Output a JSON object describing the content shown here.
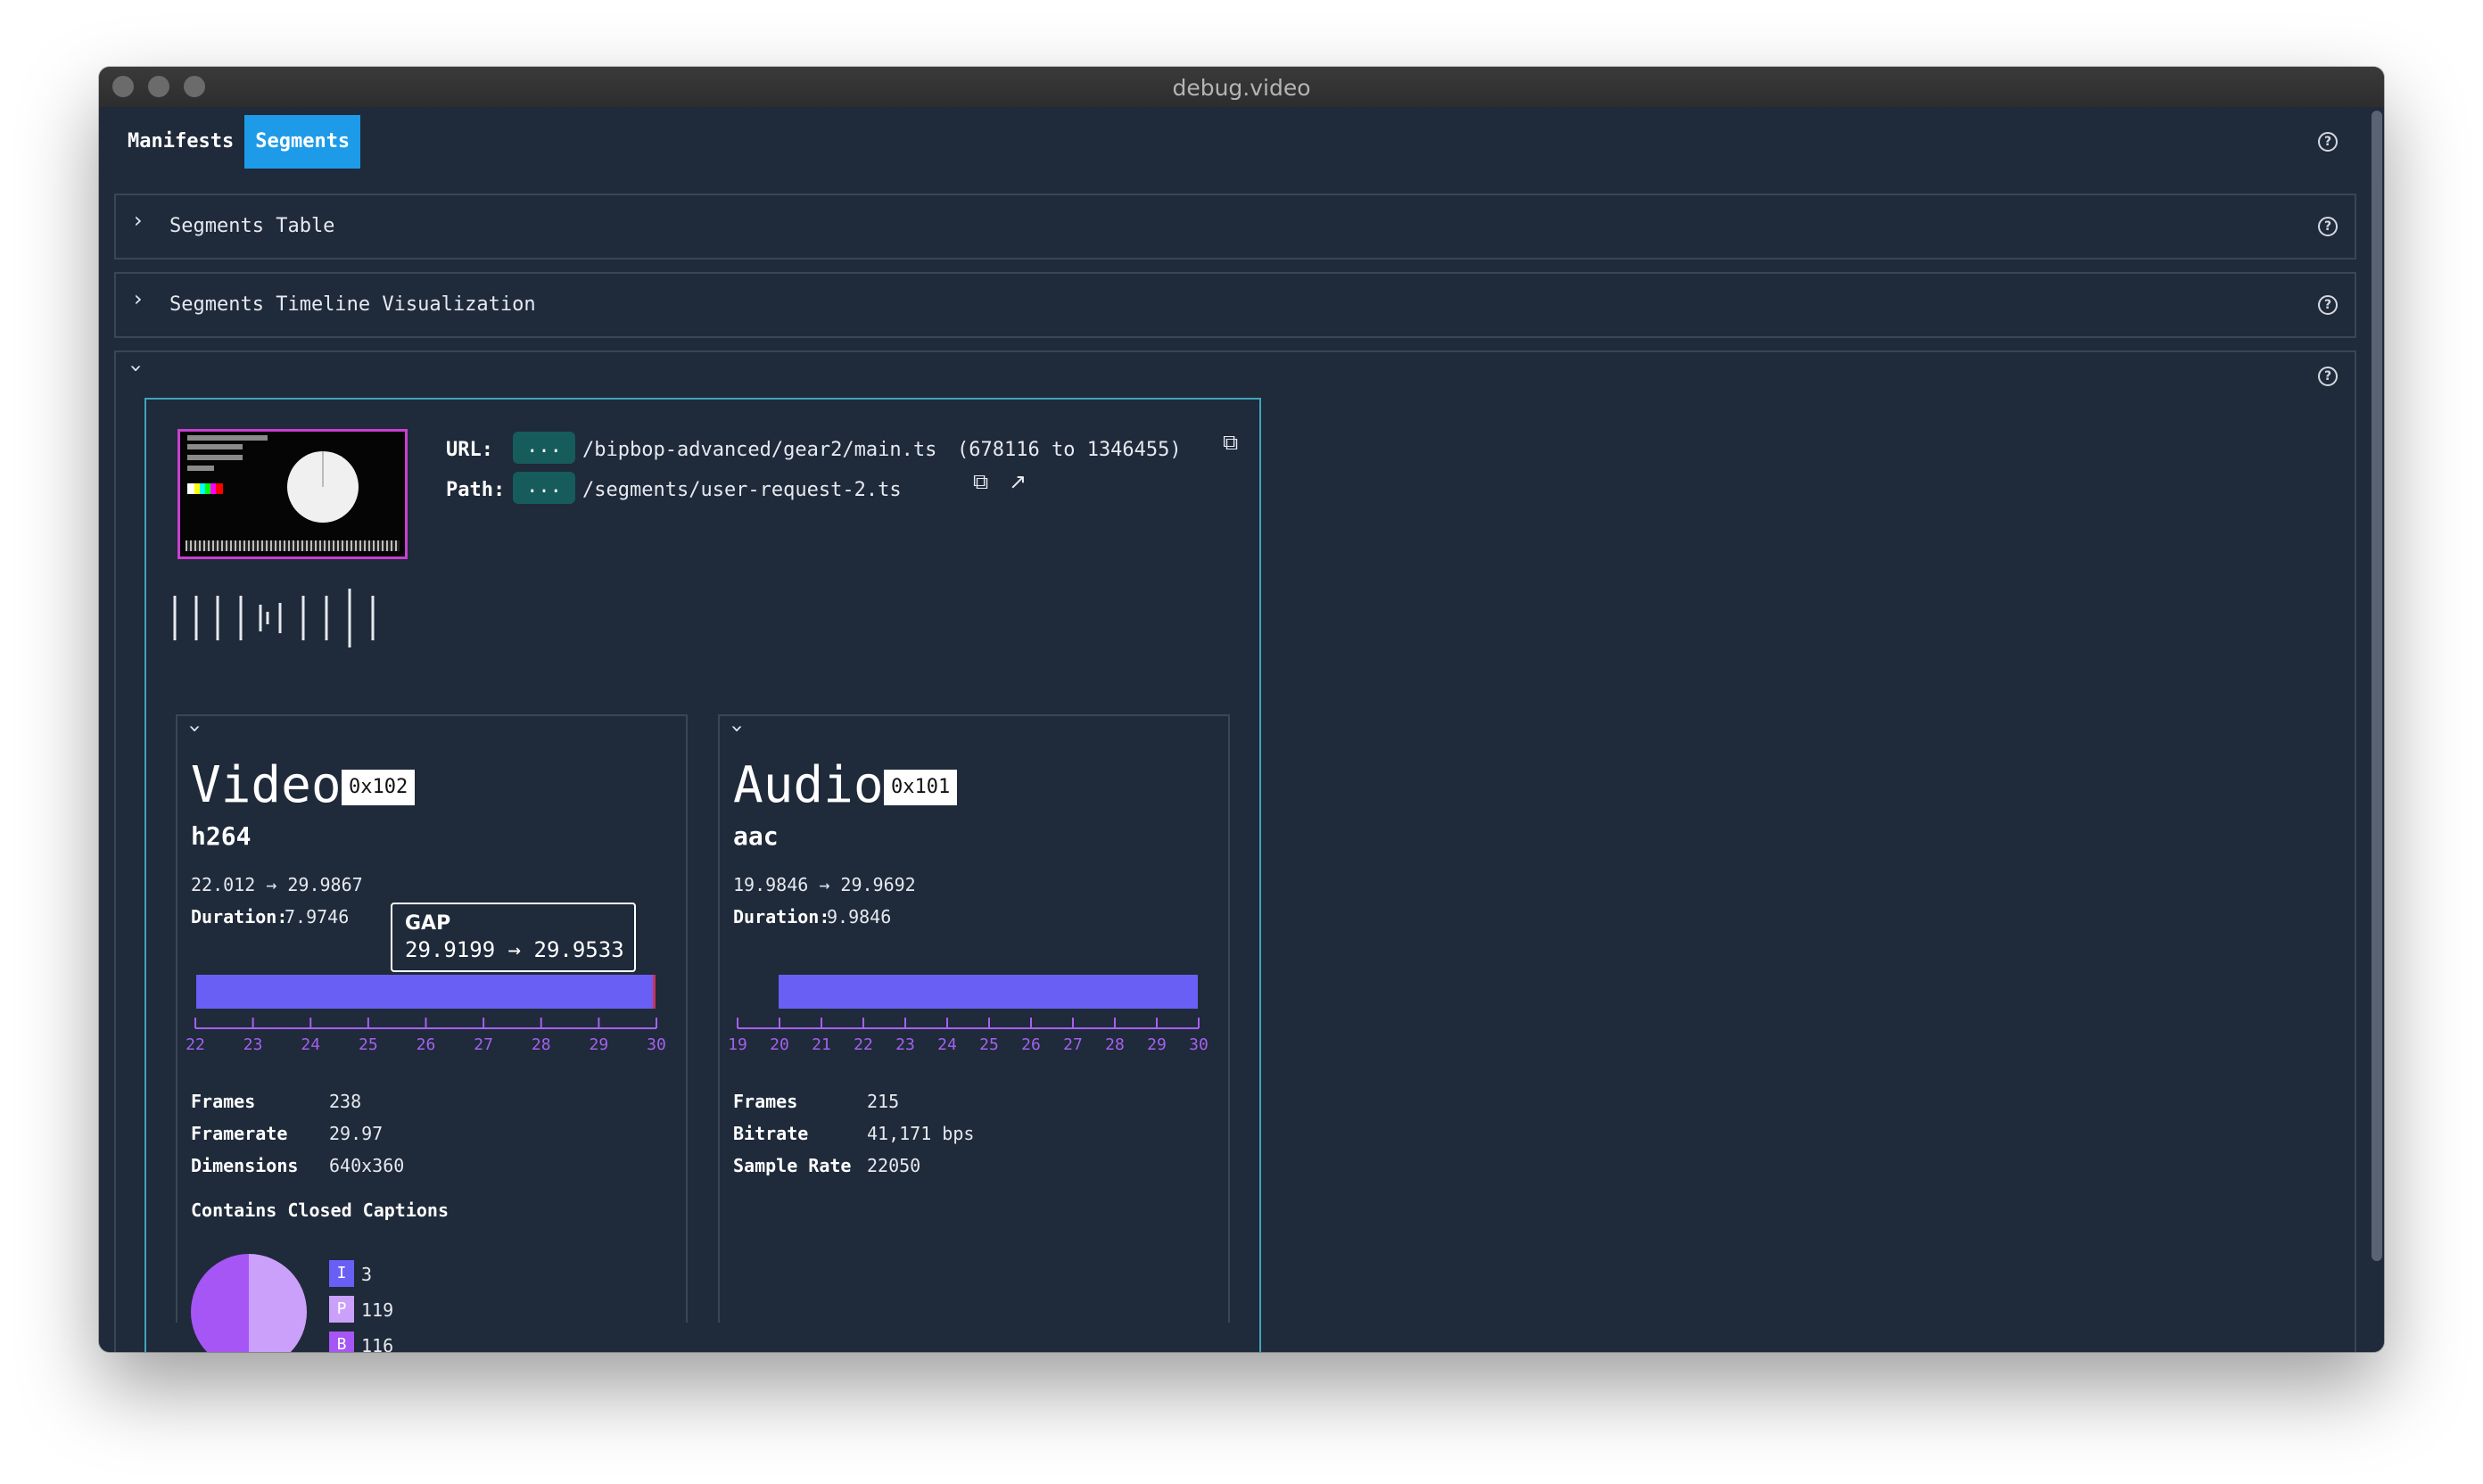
{
  "window": {
    "title": "debug.video"
  },
  "tabs": [
    {
      "label": "Manifests",
      "active": false
    },
    {
      "label": "Segments",
      "active": true
    }
  ],
  "sections": {
    "segments_table": {
      "title": "Segments Table",
      "expanded": false
    },
    "segments_timeline": {
      "title": "Segments Timeline Visualization",
      "expanded": false
    },
    "segment_detail": {
      "expanded": true
    }
  },
  "segment": {
    "url_label": "URL:",
    "url_ellipsis": "...",
    "url_path": "/bipbop-advanced/gear2/main.ts",
    "url_range": "(678116 to 1346455)",
    "path_label": "Path:",
    "path_ellipsis": "...",
    "path_value": "/segments/user-request-2.ts"
  },
  "video": {
    "title": "Video",
    "pid": "0x102",
    "codec": "h264",
    "range": "22.012 → 29.9867",
    "duration_label": "Duration:",
    "duration": "7.9746",
    "start": 22.012,
    "end": 29.9867,
    "axis_min": 22,
    "axis_max": 30,
    "ticks": [
      "22",
      "23",
      "24",
      "25",
      "26",
      "27",
      "28",
      "29",
      "30"
    ],
    "gap_tooltip": {
      "label": "GAP",
      "range": "29.9199 → 29.9533"
    },
    "stats": [
      {
        "label": "Frames",
        "value": "238"
      },
      {
        "label": "Framerate",
        "value": "29.97"
      },
      {
        "label": "Dimensions",
        "value": "640x360"
      }
    ],
    "closed_captions": "Contains Closed Captions",
    "frame_types": [
      {
        "type": "I",
        "count": "3",
        "color": "#6a5ff5"
      },
      {
        "type": "P",
        "count": "119",
        "color": "#cba0fb"
      },
      {
        "type": "B",
        "count": "116",
        "color": "#a656f5"
      }
    ]
  },
  "audio": {
    "title": "Audio",
    "pid": "0x101",
    "codec": "aac",
    "range": "19.9846 → 29.9692",
    "duration_label": "Duration:",
    "duration": "9.9846",
    "start": 19.9846,
    "end": 29.9692,
    "axis_min": 19,
    "axis_max": 30,
    "ticks": [
      "19",
      "20",
      "21",
      "22",
      "23",
      "24",
      "25",
      "26",
      "27",
      "28",
      "29",
      "30"
    ],
    "stats": [
      {
        "label": "Frames",
        "value": "215"
      },
      {
        "label": "Bitrate",
        "value": "41,171 bps"
      },
      {
        "label": "Sample Rate",
        "value": "22050"
      }
    ]
  },
  "colors": {
    "accent_tab": "#1e9be8",
    "bar": "#6a5ff5",
    "axis": "#a660f0",
    "segment_border": "#3ea6b8",
    "thumbnail_border": "#c83fd0"
  }
}
